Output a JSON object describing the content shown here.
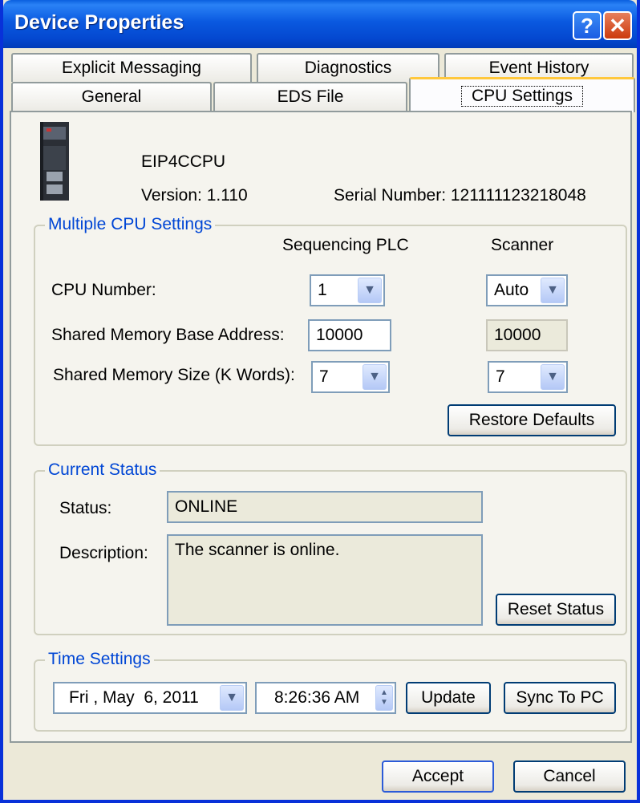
{
  "window": {
    "title": "Device Properties"
  },
  "tabs": {
    "row1": [
      "Explicit Messaging",
      "Diagnostics",
      "Event History"
    ],
    "row2": [
      "General",
      "EDS File",
      "CPU Settings"
    ],
    "active": "CPU Settings"
  },
  "device": {
    "name": "EIP4CCPU",
    "version": "Version: 1.110",
    "serial": "Serial Number: 121111123218048"
  },
  "cpu_settings": {
    "group_title": "Multiple CPU Settings",
    "col_seq": "Sequencing PLC",
    "col_scanner": "Scanner",
    "cpu_number_label": "CPU Number:",
    "shared_base_label": "Shared Memory Base Address:",
    "shared_size_label": "Shared Memory Size (K Words):",
    "seq_cpu_number": "1",
    "scanner_cpu_number": "Auto",
    "seq_base_address": "10000",
    "scanner_base_address": "10000",
    "seq_size": "7",
    "scanner_size": "7",
    "restore_label": "Restore Defaults"
  },
  "status": {
    "group_title": "Current Status",
    "status_label": "Status:",
    "status_value": "ONLINE",
    "description_label": "Description:",
    "description_value": "The scanner is online.",
    "reset_label": "Reset Status"
  },
  "time": {
    "group_title": "Time Settings",
    "date_value": "Fri , May  6, 2011",
    "time_value": "8:26:36 AM",
    "update_label": "Update",
    "sync_label": "Sync To PC"
  },
  "footer": {
    "accept_label": "Accept",
    "cancel_label": "Cancel"
  },
  "colors": {
    "title_bar": "#0a59e0",
    "group_title": "#0046d5",
    "tab_highlight": "#ffc83c"
  }
}
